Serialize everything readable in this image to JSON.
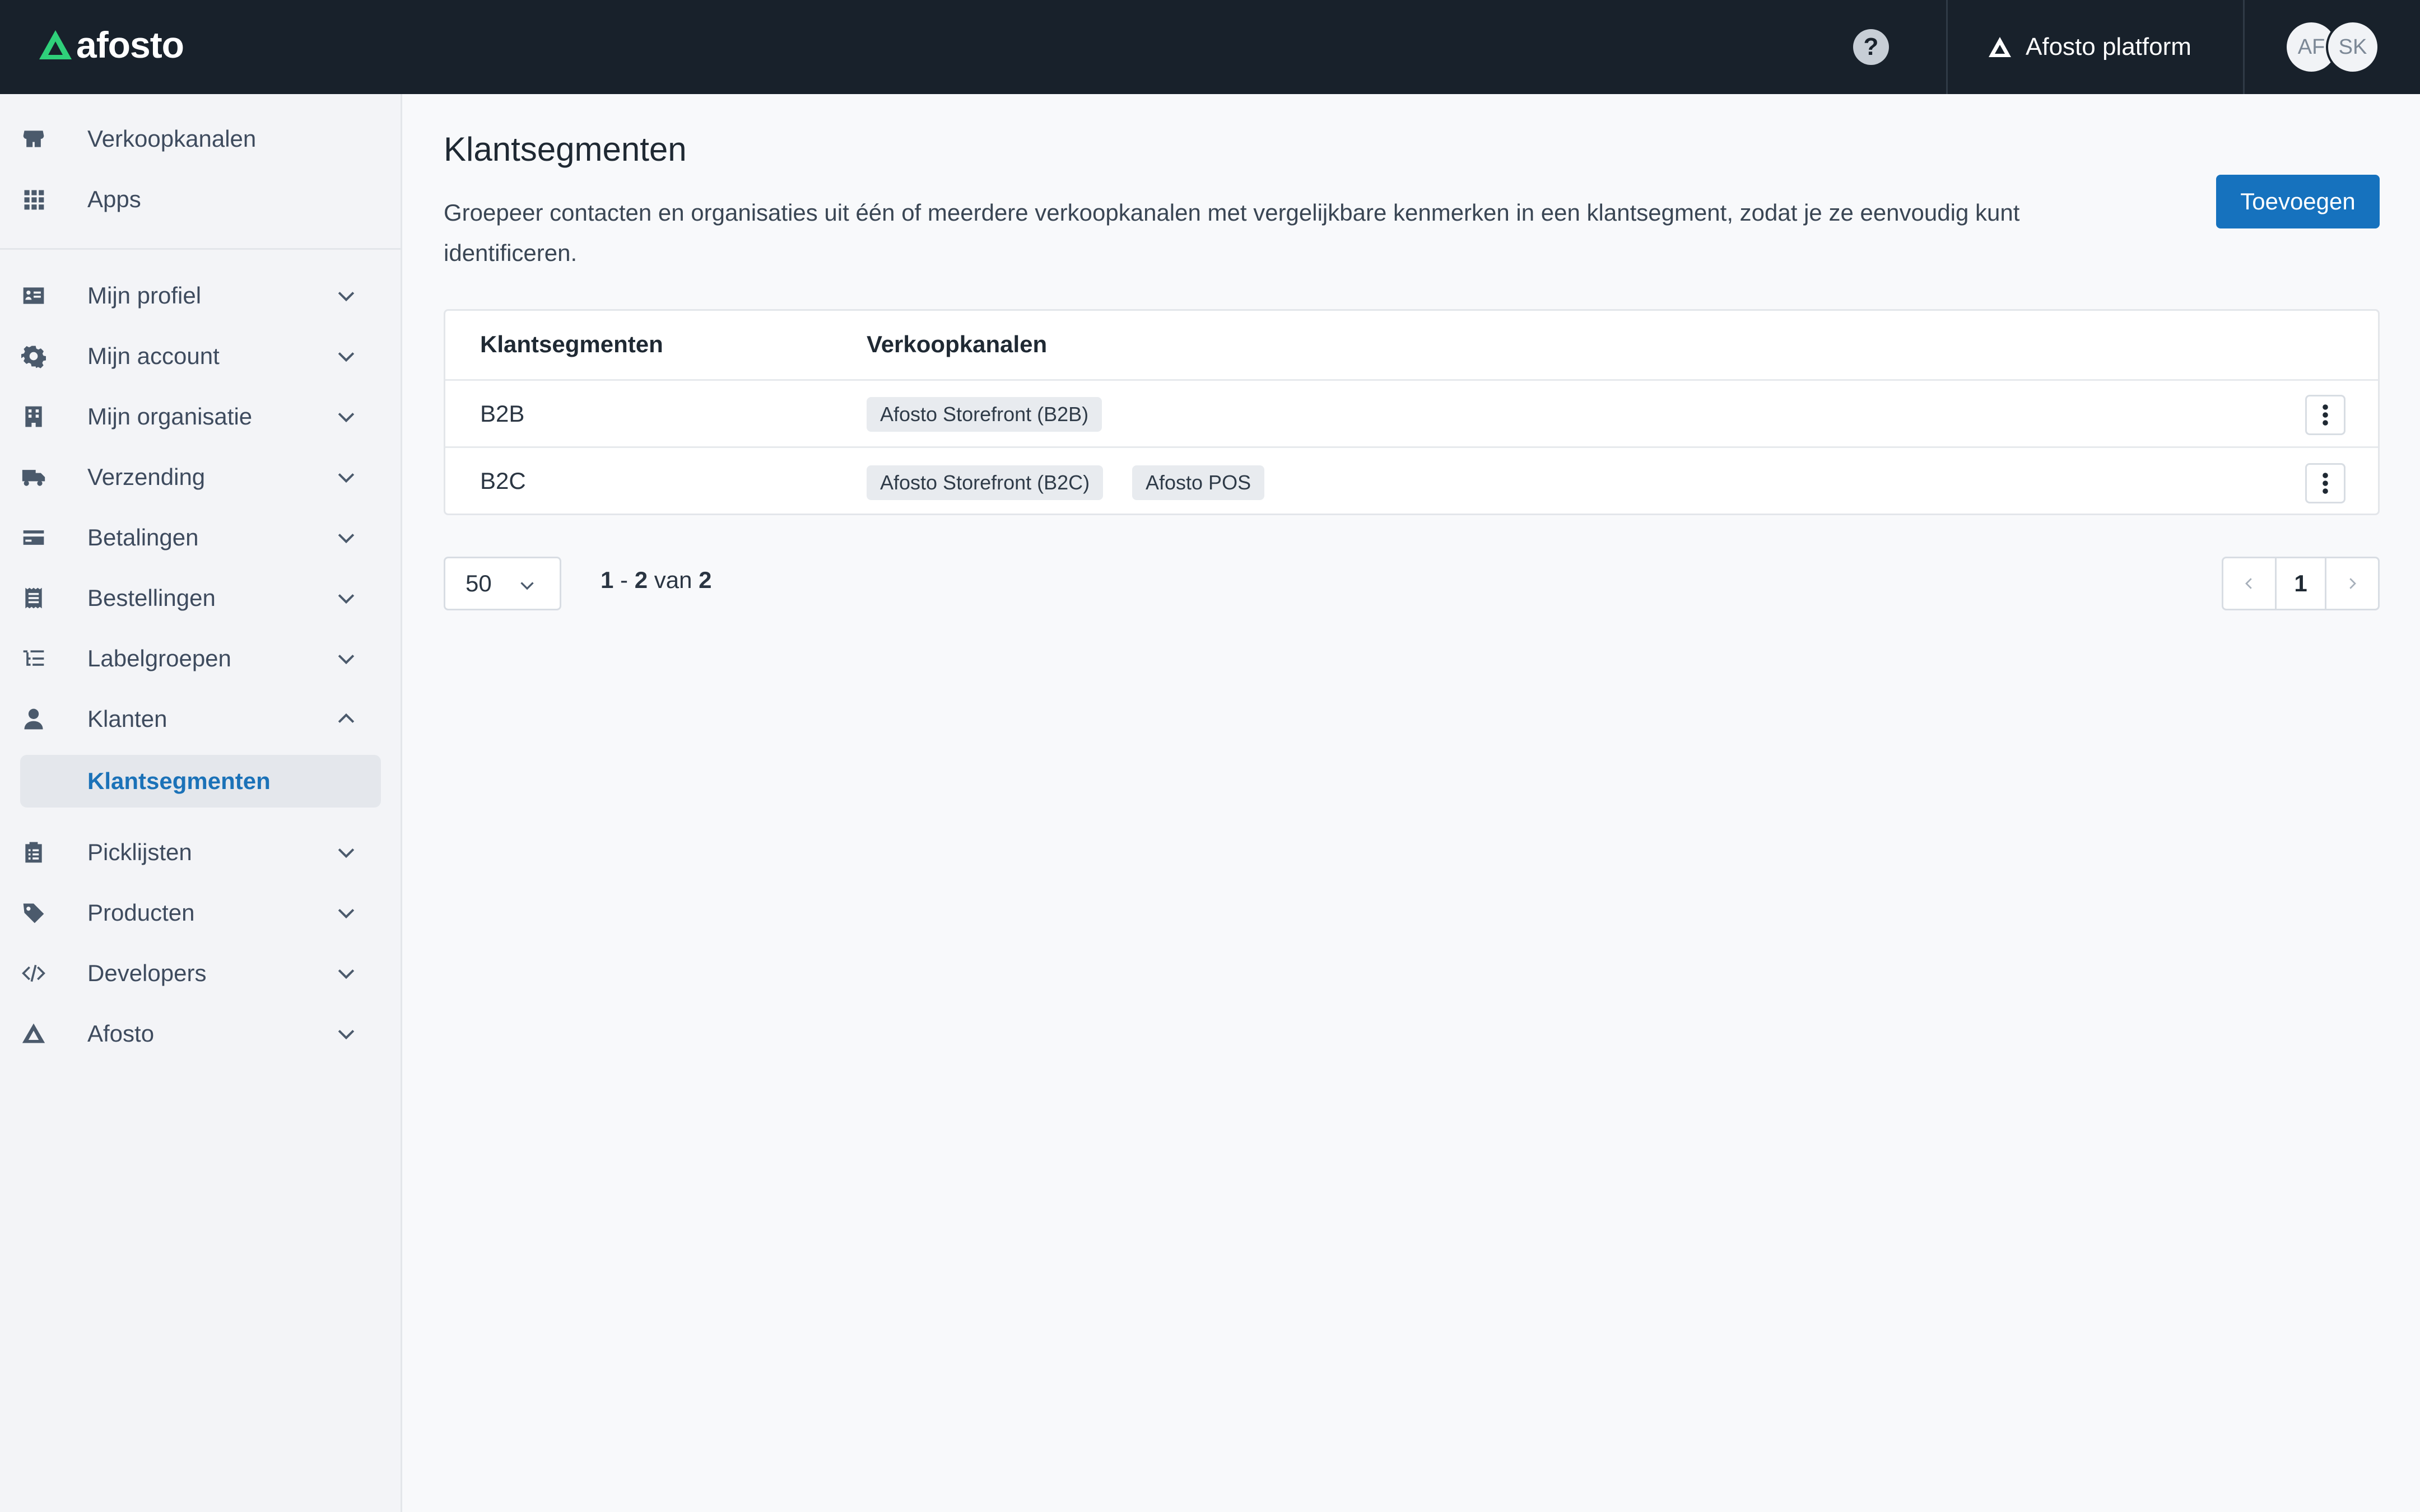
{
  "app": {
    "logo_text": "afosto",
    "help_label": "?",
    "platform_label": "Afosto platform",
    "avatars": [
      "AF",
      "SK"
    ]
  },
  "sidebar": {
    "top_items": [
      {
        "label": "Verkoopkanalen",
        "icon": "storefront-icon"
      },
      {
        "label": "Apps",
        "icon": "grid-icon"
      }
    ],
    "items": [
      {
        "label": "Mijn profiel",
        "icon": "id-card-icon",
        "expanded": false
      },
      {
        "label": "Mijn account",
        "icon": "gear-icon",
        "expanded": false
      },
      {
        "label": "Mijn organisatie",
        "icon": "building-icon",
        "expanded": false
      },
      {
        "label": "Verzending",
        "icon": "truck-icon",
        "expanded": false
      },
      {
        "label": "Betalingen",
        "icon": "credit-card-icon",
        "expanded": false
      },
      {
        "label": "Bestellingen",
        "icon": "receipt-icon",
        "expanded": false
      },
      {
        "label": "Labelgroepen",
        "icon": "tree-list-icon",
        "expanded": false
      },
      {
        "label": "Klanten",
        "icon": "user-icon",
        "expanded": true
      },
      {
        "label": "Picklijsten",
        "icon": "clipboard-icon",
        "expanded": false
      },
      {
        "label": "Producten",
        "icon": "tag-icon",
        "expanded": false
      },
      {
        "label": "Developers",
        "icon": "code-icon",
        "expanded": false
      },
      {
        "label": "Afosto",
        "icon": "afosto-logo-icon",
        "expanded": false
      }
    ],
    "active_sub_item": "Klantsegmenten"
  },
  "main": {
    "title": "Klantsegmenten",
    "description": "Groepeer contacten en organisaties uit één of meerdere verkoopkanalen met vergelijkbare kenmerken in een klantsegment, zodat je ze eenvoudig kunt identificeren.",
    "add_button": "Toevoegen",
    "table": {
      "headers": [
        "Klantsegmenten",
        "Verkoopkanalen"
      ],
      "rows": [
        {
          "segment": "B2B",
          "channels": [
            "Afosto Storefront (B2B)"
          ]
        },
        {
          "segment": "B2C",
          "channels": [
            "Afosto Storefront (B2C)",
            "Afosto POS"
          ]
        }
      ]
    },
    "pagination": {
      "per_page": "50",
      "range_start": "1",
      "range_sep": "-",
      "range_end": "2",
      "of_word": "van",
      "total": "2",
      "current_page": "1"
    }
  },
  "colors": {
    "topbar": "#18212b",
    "accent": "#1672be",
    "logo_green": "#2fd07a"
  }
}
